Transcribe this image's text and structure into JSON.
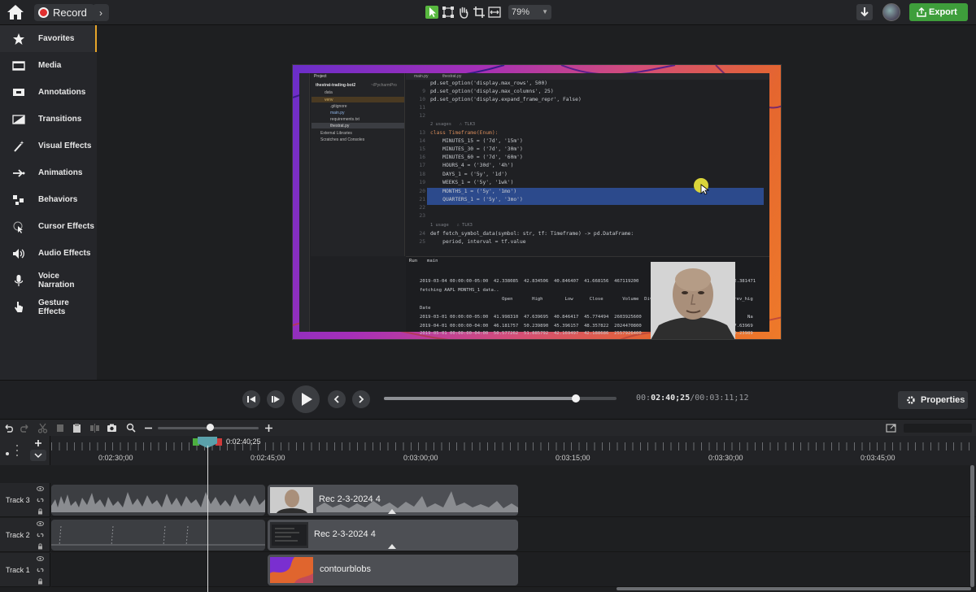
{
  "topbar": {
    "record_label": "Record",
    "zoom_value": "79%",
    "export_label": "Export"
  },
  "sidebar": {
    "items": [
      {
        "label": "Favorites",
        "icon": "star-icon"
      },
      {
        "label": "Media",
        "icon": "film-icon"
      },
      {
        "label": "Annotations",
        "icon": "annotation-icon"
      },
      {
        "label": "Transitions",
        "icon": "transition-icon"
      },
      {
        "label": "Visual Effects",
        "icon": "wand-icon"
      },
      {
        "label": "Animations",
        "icon": "arrow-animation-icon"
      },
      {
        "label": "Behaviors",
        "icon": "behaviors-icon"
      },
      {
        "label": "Cursor Effects",
        "icon": "cursor-effects-icon"
      },
      {
        "label": "Audio Effects",
        "icon": "speaker-icon"
      },
      {
        "label": "Voice Narration",
        "icon": "microphone-icon"
      },
      {
        "label": "Gesture Effects",
        "icon": "hand-pointer-icon"
      }
    ]
  },
  "preview": {
    "project_label": "Project",
    "project_root": "thestrat-trading-bot2",
    "project_root_path": "~/PycharmPro",
    "tree": [
      "data",
      "venv",
      ".gitignore",
      "main.py",
      "requirements.txt",
      "thestrat.py",
      "External Libraries",
      "Scratches and Consoles"
    ],
    "tabs": [
      "main.py",
      "thestrat.py"
    ],
    "code_lines": [
      {
        "n": "",
        "t": "pd.set_option('display.max_rows', 500)"
      },
      {
        "n": "9",
        "t": "pd.set_option('display.max_columns', 25)"
      },
      {
        "n": "10",
        "t": "pd.set_option('display.expand_frame_repr', False)"
      },
      {
        "n": "11",
        "t": ""
      },
      {
        "n": "12",
        "t": ""
      },
      {
        "n": "",
        "t": "2 usages   ∴ TLK3"
      },
      {
        "n": "13",
        "t": "class Timeframe(Enum):"
      },
      {
        "n": "14",
        "t": "    MINUTES_15 = ('7d', '15m')"
      },
      {
        "n": "15",
        "t": "    MINUTES_30 = ('7d', '30m')"
      },
      {
        "n": "16",
        "t": "    MINUTES_60 = ('7d', '60m')"
      },
      {
        "n": "17",
        "t": "    HOURS_4 = ('30d', '4h')"
      },
      {
        "n": "18",
        "t": "    DAYS_1 = ('5y', '1d')"
      },
      {
        "n": "19",
        "t": "    WEEKS_1 = ('5y', '1wk')"
      },
      {
        "n": "20",
        "t": "    MONTHS_1 = ('5y', '1mo')"
      },
      {
        "n": "21",
        "t": "    QUARTERS_1 = ('5y', '3mo')"
      },
      {
        "n": "22",
        "t": ""
      },
      {
        "n": "23",
        "t": ""
      },
      {
        "n": "",
        "t": "1 usage   ∴ TLK3"
      },
      {
        "n": "24",
        "t": "def fetch_symbol_data(symbol: str, tf: Timeframe) -> pd.DataFrame:"
      },
      {
        "n": "25",
        "t": "    period, interval = tf.value"
      }
    ],
    "run_tab": "Run",
    "run_config": "main",
    "run_lines": [
      "2019-03-04 00:00:00-05:00  42.338085  42.834506  40.846407  41.668156  467119200",
      "fetching AAPL MONTHS_1 data..",
      "                              Open       High        Low      Close       Volume  Div",
      "Date",
      "2019-03-01 00:00:00-05:00  41.998310  47.639695  40.846417  45.774494  2603925600",
      "2019-04-01 00:00:00-04:00  46.181757  50.239890  45.396157  48.357822  2024470800",
      "2019-05-01 00:00:00-04:00  50.577262  51.885792  42.169497  42.188686  2557926400"
    ],
    "run_right": [
      "0.0  42.381471",
      "its  prev_hig",
      "0.0        Na",
      "0.0  47.63969",
      "0.0  50.23989"
    ]
  },
  "transport": {
    "timecode_prefix": "00:",
    "timecode_current": "02:40;25",
    "timecode_total": "/00:03:11;12",
    "scrub_progress": 0.825,
    "properties_label": "Properties"
  },
  "timeline": {
    "playhead_time": "0:02:40;25",
    "ruler_labels": [
      "0:02:30;00",
      "0:02:45;00",
      "0:03:00;00",
      "0:03:15;00",
      "0:03:30;00",
      "0:03:45;00"
    ],
    "tracks": [
      {
        "name": "Track 3",
        "clip_label": "Rec 2-3-2024 4"
      },
      {
        "name": "Track 2",
        "clip_label": "Rec 2-3-2024 4"
      },
      {
        "name": "Track 1",
        "clip_label": "contourblobs"
      }
    ]
  },
  "colors": {
    "accent_green": "#3e9e3b",
    "record_red": "#e02f2f",
    "favorites_marker": "#e7a52a",
    "selection_blue": "#2c4a8c"
  }
}
